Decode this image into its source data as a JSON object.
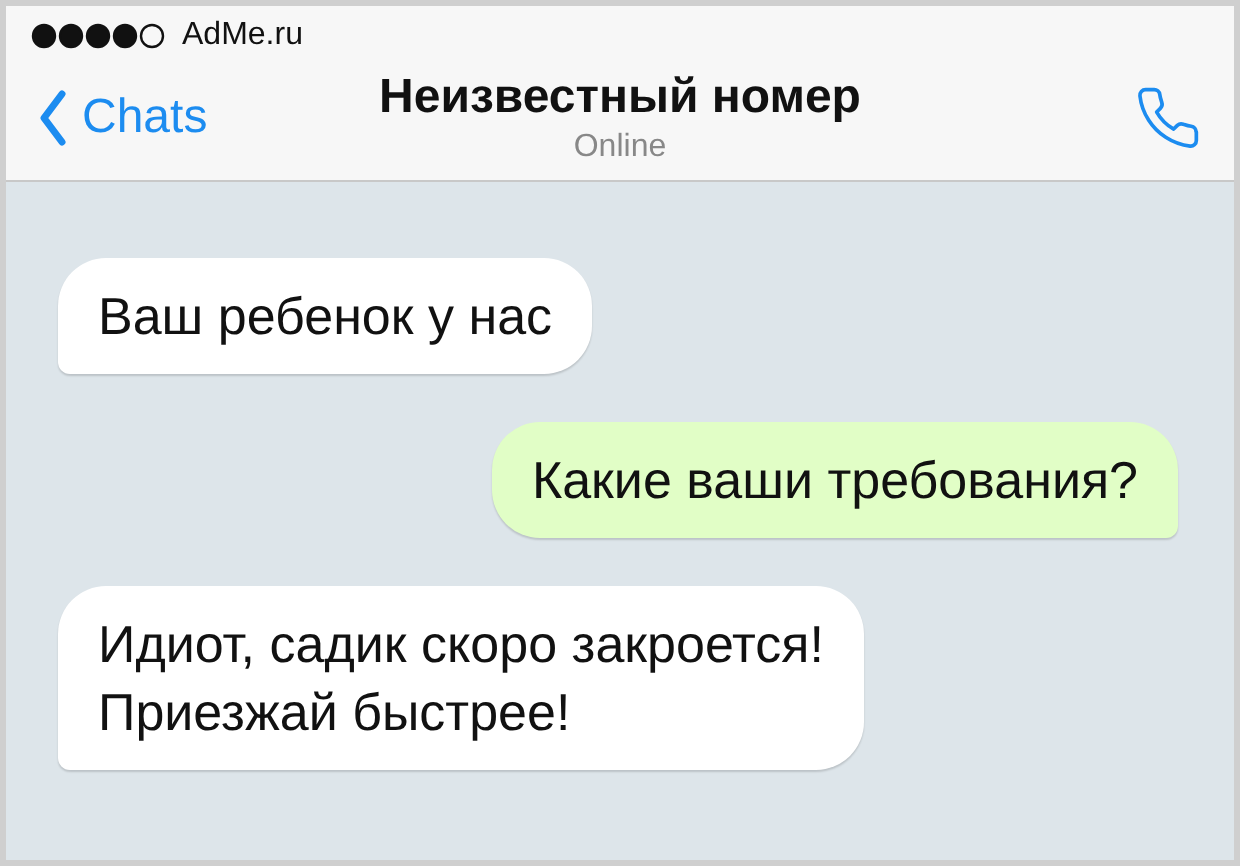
{
  "status_bar": {
    "carrier": "AdMe.ru"
  },
  "header": {
    "back": "Chats",
    "title": "Неизвестный номер",
    "subtitle": "Online"
  },
  "messages": [
    {
      "kind": "incoming",
      "lines": [
        "Ваш ребенок у нас"
      ]
    },
    {
      "kind": "outgoing",
      "lines": [
        "Какие ваши требования?"
      ]
    },
    {
      "kind": "incoming",
      "lines": [
        "Идиот, садик скоро закроется!",
        "Приезжай быстрее!"
      ]
    }
  ]
}
